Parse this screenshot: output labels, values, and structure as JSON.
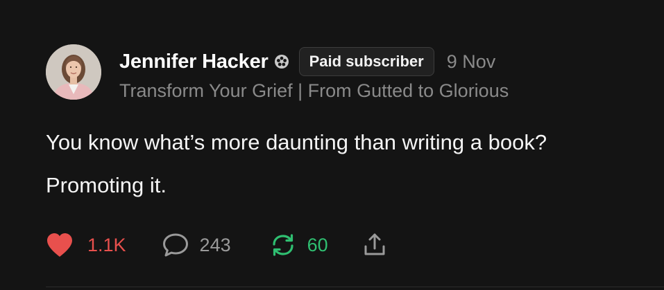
{
  "post": {
    "author": {
      "name": "Jennifer Hacker",
      "badge": "Paid subscriber",
      "publication": "Transform Your Grief | From Gutted to Glorious"
    },
    "date": "9 Nov",
    "body": [
      "You know what’s more daunting than writing a book?",
      "Promoting it."
    ],
    "stats": {
      "likes": "1.1K",
      "comments": "243",
      "restacks": "60"
    },
    "icons": {
      "verified": "flower-badge-icon",
      "like": "heart-icon",
      "comment": "speech-bubble-icon",
      "restack": "restack-arrows-icon",
      "share": "share-icon"
    }
  },
  "colors": {
    "background": "#141414",
    "like": "#e8504d",
    "restack": "#2fbf71",
    "muted": "#8a8a8a"
  }
}
